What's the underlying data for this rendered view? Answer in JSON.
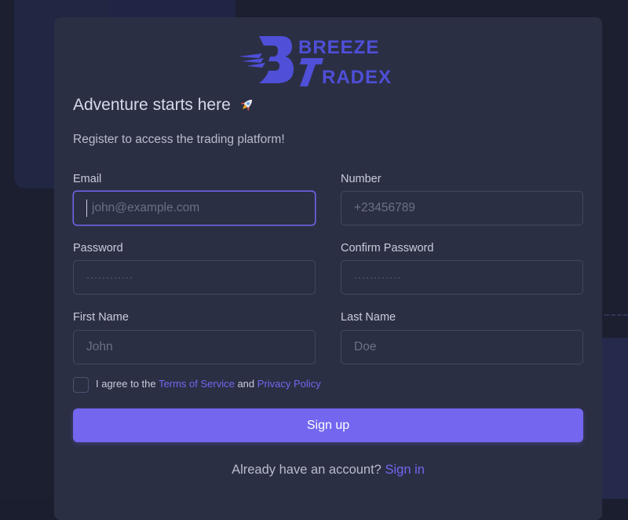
{
  "brand": {
    "name_line1": "BREEZE",
    "name_line2": "RADEX",
    "accent_color": "#4f4fd8"
  },
  "header": {
    "title": "Adventure starts here",
    "title_icon": "rocket-icon",
    "subtitle": "Register to access the trading platform!"
  },
  "form": {
    "email": {
      "label": "Email",
      "placeholder": "john@example.com",
      "value": ""
    },
    "number": {
      "label": "Number",
      "placeholder": "+23456789",
      "value": ""
    },
    "password": {
      "label": "Password",
      "placeholder": "············",
      "value": ""
    },
    "confirm_password": {
      "label": "Confirm Password",
      "placeholder": "············",
      "value": ""
    },
    "first_name": {
      "label": "First Name",
      "placeholder": "John",
      "value": ""
    },
    "last_name": {
      "label": "Last Name",
      "placeholder": "Doe",
      "value": ""
    },
    "agree": {
      "prefix": "I agree to the",
      "terms": "Terms of Service",
      "and": "and",
      "privacy": "Privacy Policy",
      "checked": false
    },
    "submit_label": "Sign up"
  },
  "footer": {
    "prompt": "Already have an account?",
    "link": "Sign in"
  },
  "colors": {
    "primary": "#7367f0",
    "card_bg": "#2b2f44",
    "page_bg": "#1c1f30"
  }
}
